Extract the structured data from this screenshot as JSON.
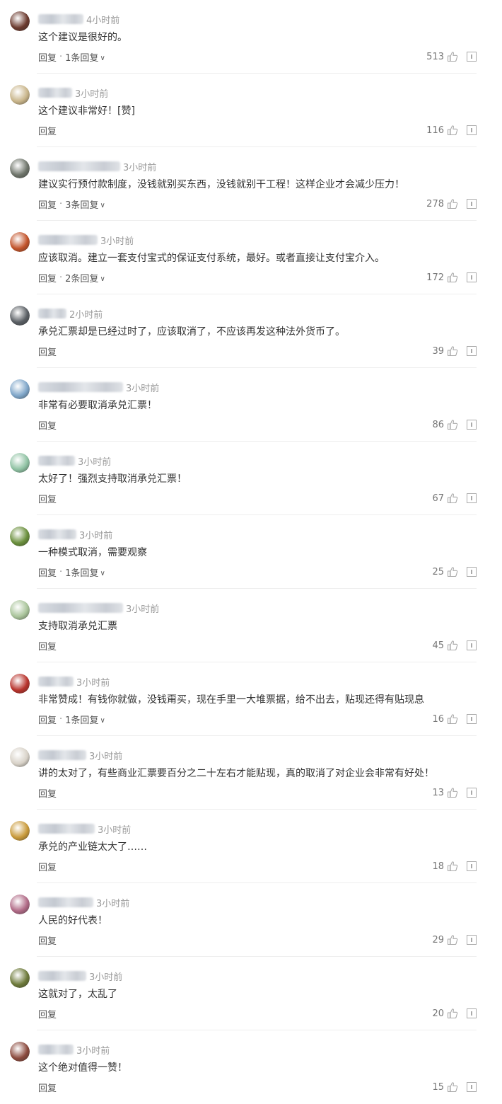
{
  "reply_label": "回复",
  "separator": "·",
  "comments": [
    {
      "time": "4小时前",
      "text": "这个建议是很好的。",
      "likes": "513",
      "replies": "1条回复",
      "avatar_color": "#6b3a2e"
    },
    {
      "time": "3小时前",
      "text": "这个建议非常好！[赞]",
      "likes": "116",
      "replies": "",
      "avatar_color": "#c9b58a"
    },
    {
      "time": "3小时前",
      "text": "建议实行预付款制度，没钱就别买东西，没钱就别干工程！这样企业才会减少压力！",
      "likes": "278",
      "replies": "3条回复",
      "avatar_color": "#6f756b"
    },
    {
      "time": "3小时前",
      "text": "应该取消。建立一套支付宝式的保证支付系统，最好。或者直接让支付宝介入。",
      "likes": "172",
      "replies": "2条回复",
      "avatar_color": "#c2532a"
    },
    {
      "time": "2小时前",
      "text": "承兑汇票却是已经过时了，应该取消了，不应该再发这种法外货币了。",
      "likes": "39",
      "replies": "",
      "avatar_color": "#5a5f64"
    },
    {
      "time": "3小时前",
      "text": "非常有必要取消承兑汇票！",
      "likes": "86",
      "replies": "",
      "avatar_color": "#7fa6c9"
    },
    {
      "time": "3小时前",
      "text": "太好了！强烈支持取消承兑汇票！",
      "likes": "67",
      "replies": "",
      "avatar_color": "#8fc2a3"
    },
    {
      "time": "3小时前",
      "text": "一种模式取消，需要观察",
      "likes": "25",
      "replies": "1条回复",
      "avatar_color": "#6a8f3c"
    },
    {
      "time": "3小时前",
      "text": "支持取消承兑汇票",
      "likes": "45",
      "replies": "",
      "avatar_color": "#a9c49a"
    },
    {
      "time": "3小时前",
      "text": "非常赞成！有钱你就做，没钱甭买，现在手里一大堆票据，给不出去，贴现还得有贴现息",
      "likes": "16",
      "replies": "1条回复",
      "avatar_color": "#b8332c"
    },
    {
      "time": "3小时前",
      "text": "讲的太对了，有些商业汇票要百分之二十左右才能贴现，真的取消了对企业会非常有好处！",
      "likes": "13",
      "replies": "",
      "avatar_color": "#d8d2c8"
    },
    {
      "time": "3小时前",
      "text": "承兑的产业链太大了……",
      "likes": "18",
      "replies": "",
      "avatar_color": "#c99a3a"
    },
    {
      "time": "3小时前",
      "text": "人民的好代表！",
      "likes": "29",
      "replies": "",
      "avatar_color": "#b06a86"
    },
    {
      "time": "3小时前",
      "text": "这就对了，太乱了",
      "likes": "20",
      "replies": "",
      "avatar_color": "#6d7a3a"
    },
    {
      "time": "3小时前",
      "text": "这个绝对值得一赞！",
      "likes": "15",
      "replies": "",
      "avatar_color": "#8b4a3e"
    }
  ],
  "accent": "#333333",
  "muted": "#9a9a9a"
}
